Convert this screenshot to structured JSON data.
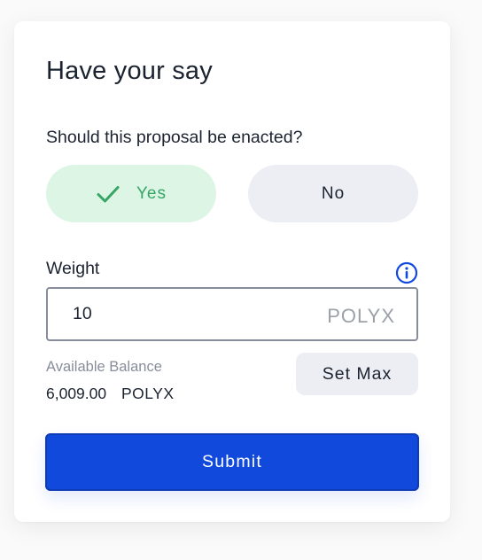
{
  "panel": {
    "title": "Have your say",
    "question": "Should this proposal be enacted?"
  },
  "vote": {
    "yes_label": "Yes",
    "no_label": "No",
    "selected": "Yes"
  },
  "weight": {
    "label": "Weight",
    "value": "10",
    "unit": "POLYX"
  },
  "balance": {
    "label": "Available Balance",
    "amount": "6,009.00",
    "unit": "POLYX",
    "set_max_label": "Set Max"
  },
  "actions": {
    "submit_label": "Submit"
  },
  "colors": {
    "yes_bg": "#dcf5e5",
    "yes_text": "#37a665",
    "neutral_bg": "#eceef4",
    "primary": "#1049dc",
    "info_icon": "#1049dc"
  },
  "icons": {
    "check": "check-icon",
    "info": "info-icon"
  }
}
